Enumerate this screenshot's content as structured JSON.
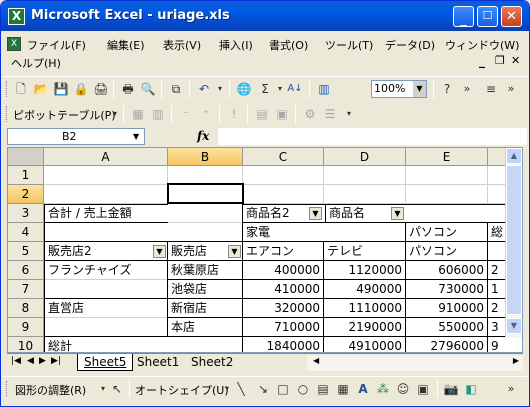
{
  "window": {
    "title": "Microsoft Excel - uriage.xls"
  },
  "menu": {
    "items": [
      "ファイル(F)",
      "編集(E)",
      "表示(V)",
      "挿入(I)",
      "書式(O)",
      "ツール(T)",
      "データ(D)",
      "ウィンドウ(W)",
      "ヘルプ(H)"
    ],
    "window_controls": [
      "_",
      "✕"
    ]
  },
  "toolbar": {
    "zoom": "100%",
    "pivot_label": "ピボットテーブル(P)"
  },
  "formula_bar": {
    "name_box": "B2",
    "fx_label": "fx",
    "formula": ""
  },
  "sheet": {
    "columns": [
      "A",
      "B",
      "C",
      "D",
      "E"
    ],
    "selected_column": "B",
    "rows": [
      "1",
      "2",
      "3",
      "4",
      "5",
      "6",
      "7",
      "8",
      "9",
      "10",
      "11"
    ],
    "selected_row": "2",
    "active_cell": "B2",
    "cells": {
      "a3": "合計 / 売上金額",
      "c3": "商品名2",
      "d3": "商品名",
      "c4": "家電",
      "e4": "パソコン",
      "f4": "総",
      "a5": "販売店2",
      "b5": "販売店",
      "c5": "エアコン",
      "d5": "テレビ",
      "e5": "パソコン",
      "a6": "フランチャイズ",
      "b6": "秋葉原店",
      "c6": "400000",
      "d6": "1120000",
      "e6": "606000",
      "f6": "2",
      "b7": "池袋店",
      "c7": "410000",
      "d7": "490000",
      "e7": "730000",
      "f7": "1",
      "a8": "直営店",
      "b8": "新宿店",
      "c8": "320000",
      "d8": "1110000",
      "e8": "910000",
      "f8": "2",
      "b9": "本店",
      "c9": "710000",
      "d9": "2190000",
      "e9": "550000",
      "f9": "3",
      "a10": "総計",
      "c10": "1840000",
      "d10": "4910000",
      "e10": "2796000",
      "f10": "9"
    }
  },
  "tabs": {
    "sheets": [
      "Sheet5",
      "Sheet1",
      "Sheet2"
    ],
    "active": "Sheet5"
  },
  "draw_toolbar": {
    "adjust_label": "図形の調整(R)",
    "autoshape_label": "オートシェイプ(U)"
  }
}
